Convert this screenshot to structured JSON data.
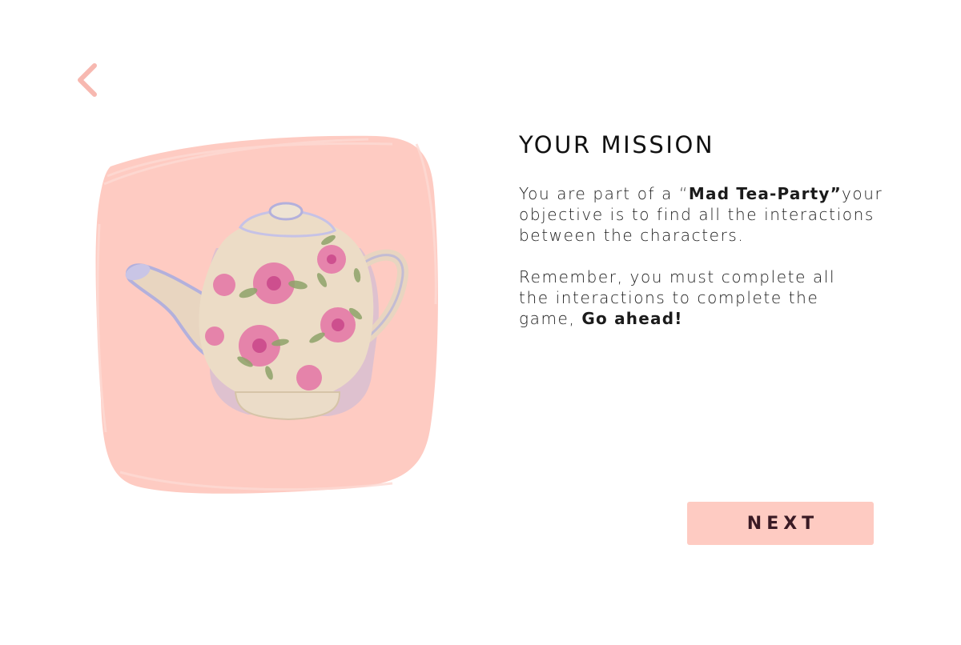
{
  "nav": {
    "back_icon": "chevron-left-icon",
    "back_color": "#f7b8b0"
  },
  "illustration": {
    "subject": "teapot",
    "background_color": "#fecbc2"
  },
  "mission": {
    "title": "YOUR MISSION",
    "para1": {
      "prefix": "You are part of a “",
      "highlight": "Mad Tea-Party”",
      "suffix": "your objective is to find all the interactions between the characters."
    },
    "para2": {
      "prefix": "Remember, you must complete all the interactions to complete the game, ",
      "highlight": "Go ahead!"
    }
  },
  "actions": {
    "next_label": "NEXT",
    "next_color": "#fecbc2"
  }
}
